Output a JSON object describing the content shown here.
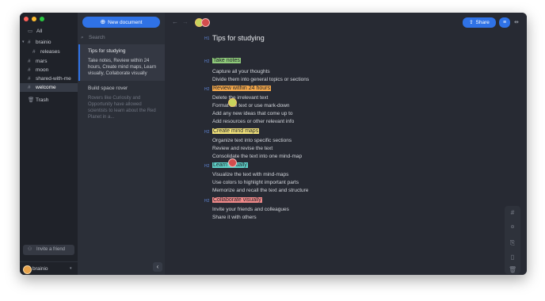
{
  "colors": {
    "accent": "#2f72e6",
    "h_take": "#8fca7a",
    "h_review": "#f2a74b",
    "h_mind": "#f2e27a",
    "h_learn": "#5fd0c7",
    "h_collab": "#f18a8a"
  },
  "sidebar": {
    "items": [
      {
        "label": "All",
        "icon": "inbox-icon"
      },
      {
        "label": "brainio",
        "icon": "hash-icon"
      },
      {
        "label": "releases",
        "icon": "hash-icon"
      },
      {
        "label": "mars",
        "icon": "hash-icon"
      },
      {
        "label": "moon",
        "icon": "hash-icon"
      },
      {
        "label": "shared-with-me",
        "icon": "hash-icon"
      },
      {
        "label": "welcome",
        "icon": "hash-icon"
      },
      {
        "label": "Trash",
        "icon": "trash-icon"
      }
    ],
    "invite_label": "Invite a friend",
    "user": "brainio"
  },
  "list": {
    "new_document": "New document",
    "search_placeholder": "Search",
    "notes": [
      {
        "title": "Tips for studying",
        "preview": "Take notes, Review within 24 hours, Create mind maps, Learn visually, Collaborate visually"
      },
      {
        "title": "Build space rover",
        "preview": "Rovers like Curiosity and Opportunity have allowed scientists to learn about the Red Planet in a..."
      }
    ]
  },
  "toolbar": {
    "share": "Share"
  },
  "document": {
    "title": "Tips for studying",
    "title_level": "H1",
    "sections": [
      {
        "level": "H2",
        "heading": "Take notes",
        "items": [
          "Capture all your thoughts",
          "Divide them into general topics or sections"
        ]
      },
      {
        "level": "H2",
        "heading": "Review within 24 hours",
        "items": [
          "Delete the irrelevant text",
          "Format the text or use mark-down",
          "Add any new ideas that come up to",
          "Add resources or other relevant info"
        ]
      },
      {
        "level": "H2",
        "heading": "Create mind maps",
        "items": [
          "Organize text into specific sections",
          "Review and revise the text",
          "Consolidate the text into one mind-map"
        ]
      },
      {
        "level": "H2",
        "heading": "Learn visually",
        "items": [
          "Visualize the text with mind-maps",
          "Use colors to highlight important parts",
          "Memorize and recall the text and structure"
        ]
      },
      {
        "level": "H2",
        "heading": "Collaborate visually",
        "items": [
          "Invite your friends and colleagues",
          "Share it with others"
        ]
      }
    ]
  }
}
